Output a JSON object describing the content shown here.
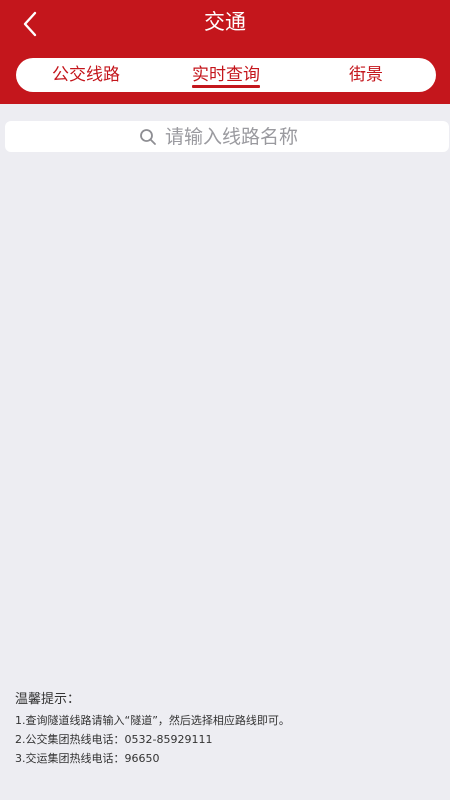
{
  "header": {
    "title": "交通",
    "back_icon": "chevron-left-icon",
    "background_color": "#c4161c"
  },
  "tabs": [
    {
      "label": "公交线路",
      "active": false
    },
    {
      "label": "实时查询",
      "active": true
    },
    {
      "label": "街景",
      "active": false
    }
  ],
  "search": {
    "placeholder": "请输入线路名称",
    "icon": "search-icon"
  },
  "tips": {
    "title": "温馨提示：",
    "lines": [
      "1.查询隧道线路请输入“隧道”，然后选择相应路线即可。",
      "2.公交集团热线电话：0532-85929111",
      "3.交运集团热线电话：96650"
    ]
  }
}
